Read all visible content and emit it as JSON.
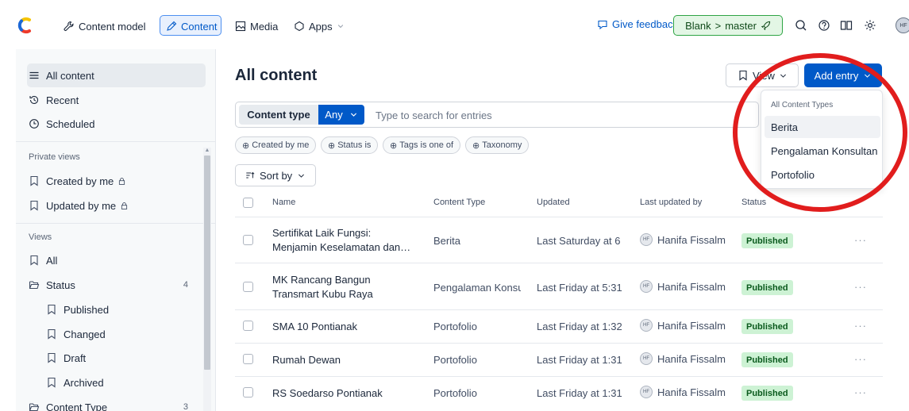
{
  "nav": {
    "items": [
      "Content model",
      "Content",
      "Media",
      "Apps"
    ],
    "feedback": "Give feedback",
    "env_space": "Blank",
    "env_sep": ">",
    "env_branch": "master",
    "avatar": "HF"
  },
  "sidebar": {
    "top": [
      "All content",
      "Recent",
      "Scheduled"
    ],
    "private_heading": "Private views",
    "private": [
      "Created by me",
      "Updated by me"
    ],
    "views_heading": "Views",
    "all": "All",
    "status_label": "Status",
    "status_count": "4",
    "status_items": [
      "Published",
      "Changed",
      "Draft",
      "Archived"
    ],
    "ctype_label": "Content Type",
    "ctype_count": "3"
  },
  "main": {
    "title": "All content",
    "view_label": "View",
    "add_label": "Add entry",
    "search": {
      "ct_label": "Content type",
      "ct_value": "Any",
      "placeholder": "Type to search for entries"
    },
    "chips": [
      "Created by me",
      "Status is",
      "Tags is one of",
      "Taxonomy"
    ],
    "sort_label": "Sort by",
    "columns": [
      "Name",
      "Content Type",
      "Updated",
      "Last updated by",
      "Status"
    ],
    "rows": [
      {
        "name": "Sertifikat Laik Fungsi: Menjamin Keselamatan dan…",
        "type": "Berita",
        "updated": "Last Saturday at 6",
        "by": "Hanifa Fissalm",
        "status": "Published"
      },
      {
        "name": "MK Rancang Bangun Transmart Kubu Raya",
        "type": "Pengalaman Konsu",
        "updated": "Last Friday at 5:31",
        "by": "Hanifa Fissalm",
        "status": "Published"
      },
      {
        "name": "SMA 10 Pontianak",
        "type": "Portofolio",
        "updated": "Last Friday at 1:32",
        "by": "Hanifa Fissalm",
        "status": "Published"
      },
      {
        "name": "Rumah Dewan",
        "type": "Portofolio",
        "updated": "Last Friday at 1:31",
        "by": "Hanifa Fissalm",
        "status": "Published"
      },
      {
        "name": "RS Soedarso Pontianak",
        "type": "Portofolio",
        "updated": "Last Friday at 1:31",
        "by": "Hanifa Fissalm",
        "status": "Published"
      }
    ],
    "row_avatar": "HF",
    "more": "···"
  },
  "dropdown": {
    "heading": "All Content Types",
    "items": [
      "Berita",
      "Pengalaman Konsultan",
      "Portofolio"
    ]
  },
  "colors": {
    "accent": "#0059c8",
    "published_bg": "#cdf2d4",
    "annotation_ring": "#e11d1d"
  }
}
